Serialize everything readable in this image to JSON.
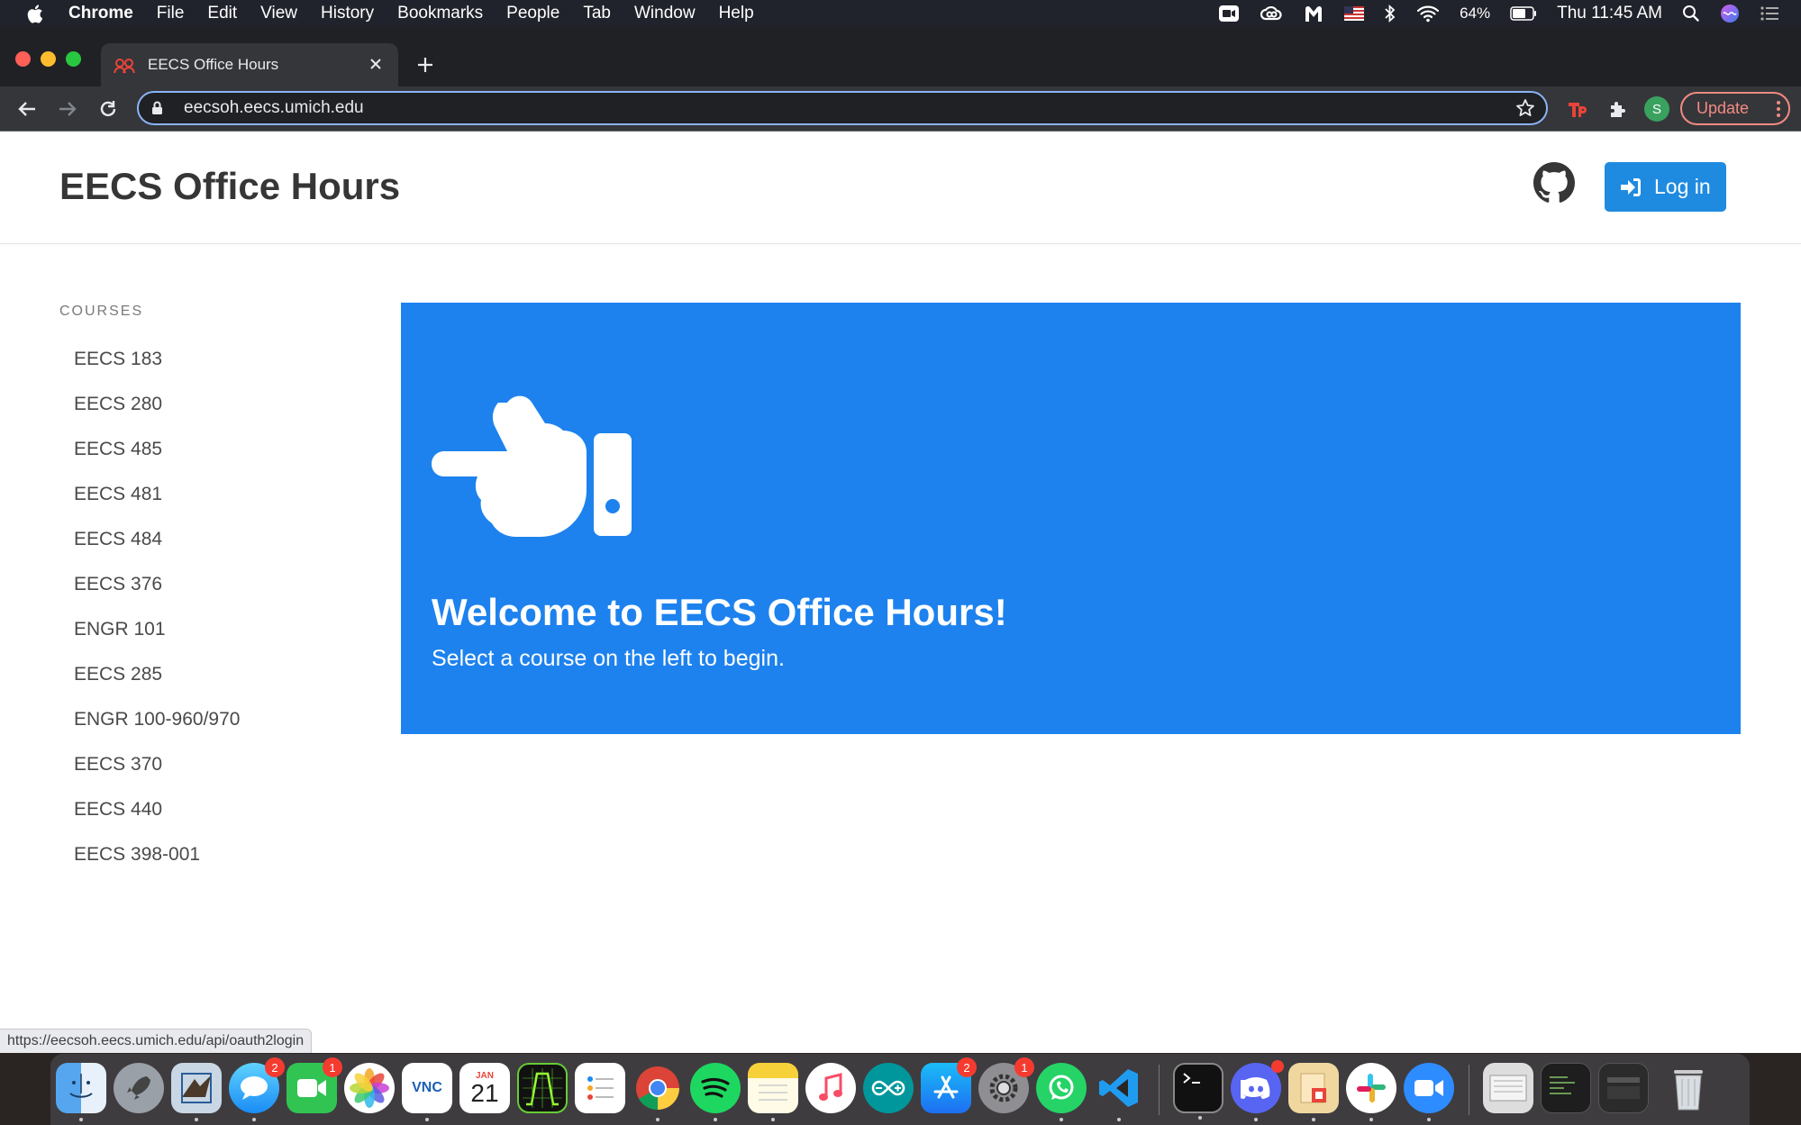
{
  "menubar": {
    "items": [
      "Chrome",
      "File",
      "Edit",
      "View",
      "History",
      "Bookmarks",
      "People",
      "Tab",
      "Window",
      "Help"
    ],
    "battery": "64%",
    "clock": "Thu 11:45 AM"
  },
  "browser": {
    "tab_title": "EECS Office Hours",
    "url": "eecsoh.eecs.umich.edu",
    "profile_initial": "S",
    "update_label": "Update",
    "status_url": "https://eecsoh.eecs.umich.edu/api/oauth2login"
  },
  "site": {
    "title": "EECS Office Hours",
    "login_label": "Log in"
  },
  "sidebar": {
    "label": "COURSES",
    "courses": [
      "EECS 183",
      "EECS 280",
      "EECS 485",
      "EECS 481",
      "EECS 484",
      "EECS 376",
      "ENGR 101",
      "EECS 285",
      "ENGR 100-960/970",
      "EECS 370",
      "EECS 440",
      "EECS 398-001"
    ]
  },
  "hero": {
    "heading": "Welcome to EECS Office Hours!",
    "subheading": "Select a course on the left to begin.",
    "icon": "hand-point-left-icon",
    "color": "#1d82ee"
  },
  "dock": {
    "calendar_month": "JAN",
    "calendar_day": "21",
    "vnc_label": "VNC",
    "badges": {
      "messages": "2",
      "facetime": "1",
      "appstore": "2",
      "preferences": "1"
    }
  }
}
